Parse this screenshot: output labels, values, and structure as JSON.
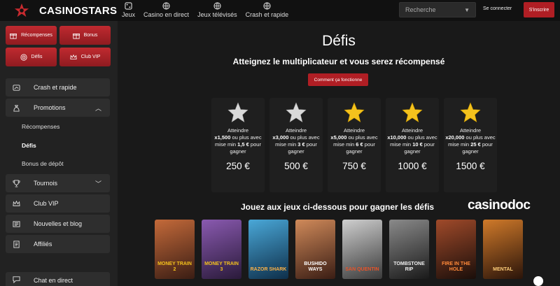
{
  "header": {
    "brand": "CASINOSTARS",
    "nav": [
      {
        "label": "Jeux",
        "icon": "dice-icon"
      },
      {
        "label": "Casino en direct",
        "icon": "globe-icon"
      },
      {
        "label": "Jeux télévisés",
        "icon": "globe-icon"
      },
      {
        "label": "Crash et rapide",
        "icon": "globe-icon"
      }
    ],
    "search_placeholder": "Recherche",
    "login_label": "Se connecter",
    "signup_label": "S'inscrire"
  },
  "sidebar": {
    "promo_buttons": [
      {
        "label": "Récompenses",
        "icon": "gift-icon"
      },
      {
        "label": "Bonus",
        "icon": "gift-icon"
      },
      {
        "label": "Défis",
        "icon": "target-icon"
      },
      {
        "label": "Club VIP",
        "icon": "crown-icon"
      }
    ],
    "items": [
      {
        "label": "Crash et rapide",
        "icon": "crash-icon"
      },
      {
        "label": "Promotions",
        "icon": "money-bag-icon"
      },
      {
        "label": "Tournois",
        "icon": "trophy-icon"
      },
      {
        "label": "Club VIP",
        "icon": "crown-icon"
      },
      {
        "label": "Nouvelles et blog",
        "icon": "newspaper-icon"
      },
      {
        "label": "Affiliés",
        "icon": "document-icon"
      }
    ],
    "sub_items": [
      "Récompenses",
      "Défis",
      "Bonus de dépôt"
    ],
    "chat_label": "Chat en direct"
  },
  "main": {
    "title": "Défis",
    "subtitle": "Atteignez le multiplicateur et vous serez récompensé",
    "how_button": "Comment ça fonctionne",
    "challenges": [
      {
        "pre": "Atteindre",
        "mult": "x1,500",
        "mid": " ou plus avec mise min",
        "min": "1,5 €",
        "post": " pour gagner",
        "reward": "250 €",
        "star": "silver"
      },
      {
        "pre": "Atteindre",
        "mult": "x3,000",
        "mid": " ou plus avec mise min",
        "min": "3 €",
        "post": " pour gagner",
        "reward": "500 €",
        "star": "silver"
      },
      {
        "pre": "Atteindre",
        "mult": "x5,000",
        "mid": " ou plus avec mise min",
        "min": "6 €",
        "post": " pour gagner",
        "reward": "750 €",
        "star": "gold"
      },
      {
        "pre": "Atteindre",
        "mult": "x10,000",
        "mid": " ou plus avec mise min",
        "min": "10 €",
        "post": " pour gagner",
        "reward": "1000 €",
        "star": "gold"
      },
      {
        "pre": "Atteindre",
        "mult": "x20,000",
        "mid": " ou plus avec mise min",
        "min": "25 €",
        "post": " pour gagner",
        "reward": "1500 €",
        "star": "gold"
      }
    ],
    "games_title": "Jouez aux jeux ci-dessous pour gagner les défis",
    "brand": "casinodoc",
    "games": [
      {
        "name": "MONEY TRAIN 2",
        "color": "#6b3b2a"
      },
      {
        "name": "MONEY TRAIN 3",
        "color": "#5a3a6e"
      },
      {
        "name": "RAZOR SHARK",
        "color": "#1d5f8c"
      },
      {
        "name": "BUSHIDO WAYS",
        "color": "#7a4a3a"
      },
      {
        "name": "SAN QUENTIN",
        "color": "#5a5a5a"
      },
      {
        "name": "TOMBSTONE RIP",
        "color": "#3a3a3a"
      },
      {
        "name": "FIRE IN THE HOLE",
        "color": "#3a1f15"
      },
      {
        "name": "MENTAL",
        "color": "#5a3a1a"
      }
    ]
  },
  "colors": {
    "accent": "#b01e24",
    "gold_star": "#f4c21d",
    "silver_star": "#d9d9d9"
  }
}
